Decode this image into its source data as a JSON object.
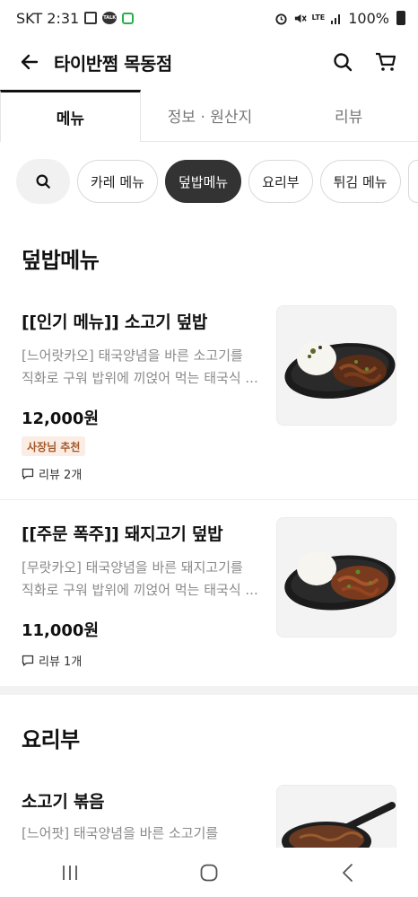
{
  "status": {
    "carrier_time": "SKT 2:31",
    "net": "LTE",
    "battery": "100%"
  },
  "header": {
    "title": "타이반쩜 목동점"
  },
  "tabs": [
    {
      "label": "메뉴"
    },
    {
      "label": "정보 · 원산지"
    },
    {
      "label": "리뷰"
    }
  ],
  "chips": [
    {
      "label": "카레 메뉴"
    },
    {
      "label": "덮밥메뉴"
    },
    {
      "label": "요리부"
    },
    {
      "label": "튀김 메뉴"
    }
  ],
  "sections": [
    {
      "title": "덮밥메뉴",
      "items": [
        {
          "name": "[[인기 메뉴]] 소고기 덮밥",
          "desc_line1": "[느어랏카오] 태국양념을 바른 소고기를",
          "desc_line2": "직화로 구워 밥위에 끼얹어 먹는 태국식 ...",
          "price": "12,000원",
          "badge": "사장님 추천",
          "review": "리뷰 2개"
        },
        {
          "name": "[[주문 폭주]] 돼지고기 덮밥",
          "desc_line1": "[무랏카오] 태국양념을 바른 돼지고기를",
          "desc_line2": "직화로 구워 밥위에 끼얹어 먹는 태국식 ...",
          "price": "11,000원",
          "review": "리뷰 1개"
        }
      ]
    },
    {
      "title": "요리부",
      "items": [
        {
          "name": "소고기 볶음",
          "desc_line1": "[느어팟] 태국양념을 바른 소고기를"
        }
      ]
    }
  ],
  "colors": {
    "active_chip": "#333333",
    "badge_bg": "#fbece4",
    "badge_text": "#a25a2b",
    "desc_text": "#8a8a8a"
  }
}
